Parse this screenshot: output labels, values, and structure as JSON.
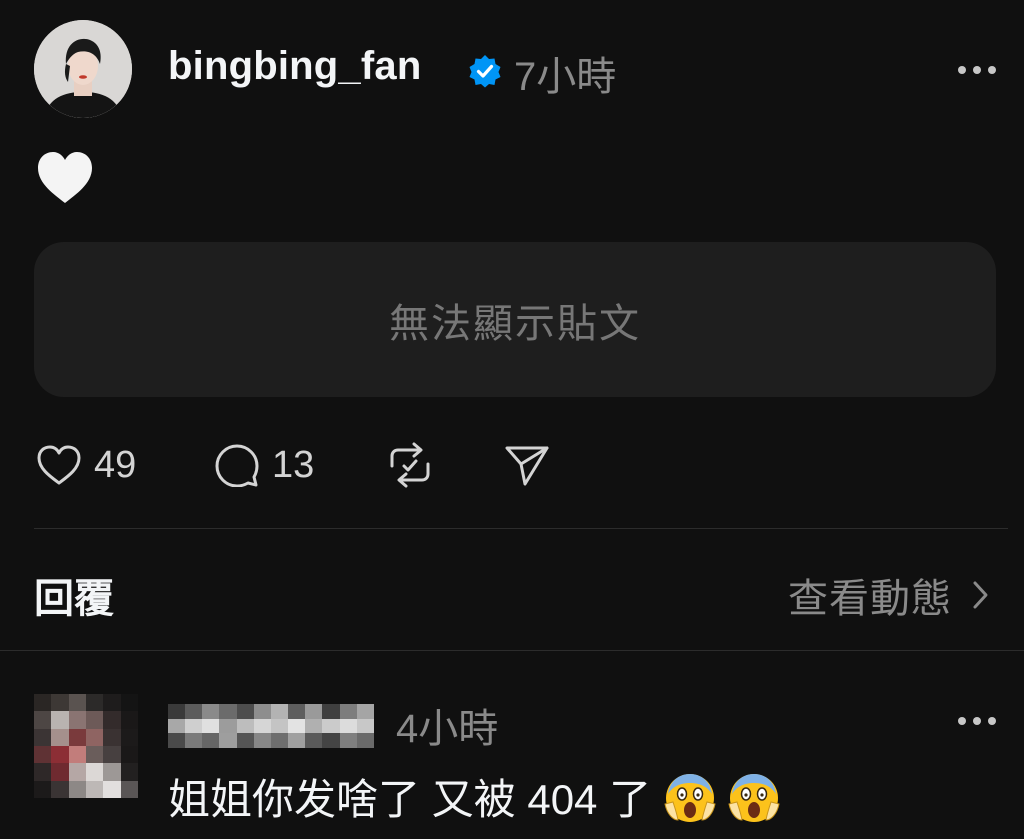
{
  "post": {
    "username": "bingbing_fan",
    "time": "7小時",
    "body_emoji_icon": "white-heart-icon",
    "unavailable_text": "無法顯示貼文",
    "stats": {
      "likes": "49",
      "comments": "13"
    }
  },
  "section": {
    "replies_label": "回覆",
    "activity_label": "查看動態"
  },
  "reply": {
    "time": "4小時",
    "text": "姐姐你发啥了 又被 404 了",
    "emojis": [
      "scream-emoji-icon",
      "scream-emoji-icon"
    ]
  },
  "colors": {
    "background": "#101010",
    "verified": "#0095f6",
    "card": "#1e1e1e",
    "muted_text": "#8a8a8a"
  }
}
